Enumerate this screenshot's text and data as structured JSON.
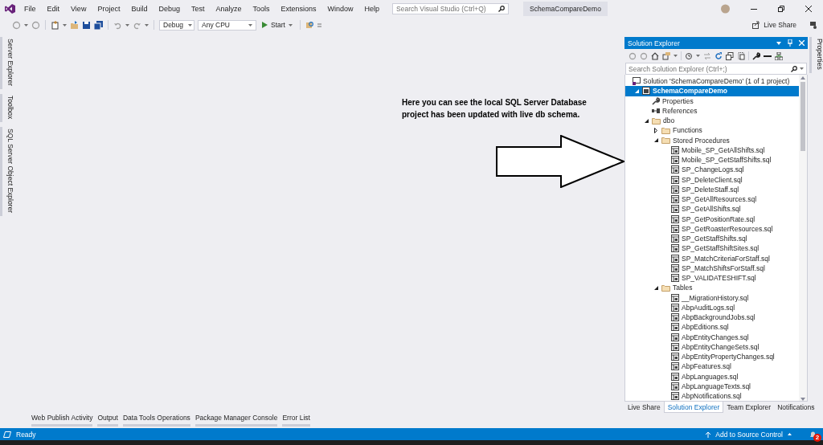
{
  "window": {
    "menu": [
      "File",
      "Edit",
      "View",
      "Project",
      "Build",
      "Debug",
      "Test",
      "Analyze",
      "Tools",
      "Extensions",
      "Window",
      "Help"
    ],
    "search": {
      "placeholder": "Search Visual Studio (Ctrl+Q)"
    },
    "solution_name": "SchemaCompareDemo"
  },
  "toolbar": {
    "configuration": "Debug",
    "platform": "Any CPU",
    "start": "Start",
    "live_share": "Live Share"
  },
  "left_tabs": [
    "Server Explorer",
    "Toolbox",
    "SQL Server Object Explorer"
  ],
  "right_tabs": [
    "Properties"
  ],
  "annotation": {
    "text": "Here you can see the local SQL Server Database\nproject has been updated with live db schema."
  },
  "solution_explorer": {
    "title": "Solution Explorer",
    "search": {
      "placeholder": "Search Solution Explorer (Ctrl+;)"
    },
    "tree": [
      {
        "label": "Solution 'SchemaCompareDemo' (1 of 1 project)",
        "kind": "solution",
        "selected": false,
        "children": [
          {
            "label": "SchemaCompareDemo",
            "kind": "project",
            "selected": true,
            "expanded": true,
            "children": [
              {
                "label": "Properties",
                "kind": "properties",
                "selected": false
              },
              {
                "label": "References",
                "kind": "references",
                "selected": false
              },
              {
                "label": "dbo",
                "kind": "folder",
                "selected": false,
                "expanded": true,
                "children": [
                  {
                    "label": "Functions",
                    "kind": "folder",
                    "selected": false,
                    "expanded": false
                  },
                  {
                    "label": "Stored Procedures",
                    "kind": "folder",
                    "selected": false,
                    "expanded": true,
                    "children": [
                      {
                        "label": "Mobile_SP_GetAllShifts.sql",
                        "kind": "file",
                        "selected": false
                      },
                      {
                        "label": "Mobile_SP_GetStaffShifts.sql",
                        "kind": "file",
                        "selected": false
                      },
                      {
                        "label": "SP_ChangeLogs.sql",
                        "kind": "file",
                        "selected": false
                      },
                      {
                        "label": "SP_DeleteClient.sql",
                        "kind": "file",
                        "selected": false
                      },
                      {
                        "label": "SP_DeleteStaff.sql",
                        "kind": "file",
                        "selected": false
                      },
                      {
                        "label": "SP_GetAllResources.sql",
                        "kind": "file",
                        "selected": false
                      },
                      {
                        "label": "SP_GetAllShifts.sql",
                        "kind": "file",
                        "selected": false
                      },
                      {
                        "label": "SP_GetPositionRate.sql",
                        "kind": "file",
                        "selected": false
                      },
                      {
                        "label": "SP_GetRoasterResources.sql",
                        "kind": "file",
                        "selected": false
                      },
                      {
                        "label": "SP_GetStaffShifts.sql",
                        "kind": "file",
                        "selected": false
                      },
                      {
                        "label": "SP_GetStaffShiftSites.sql",
                        "kind": "file",
                        "selected": false
                      },
                      {
                        "label": "SP_MatchCriteriaForStaff.sql",
                        "kind": "file",
                        "selected": false
                      },
                      {
                        "label": "SP_MatchShiftsForStaff.sql",
                        "kind": "file",
                        "selected": false
                      },
                      {
                        "label": "SP_VALIDATESHIFT.sql",
                        "kind": "file",
                        "selected": false
                      }
                    ]
                  },
                  {
                    "label": "Tables",
                    "kind": "folder",
                    "selected": false,
                    "expanded": true,
                    "children": [
                      {
                        "label": "__MigrationHistory.sql",
                        "kind": "file",
                        "selected": false
                      },
                      {
                        "label": "AbpAuditLogs.sql",
                        "kind": "file",
                        "selected": false
                      },
                      {
                        "label": "AbpBackgroundJobs.sql",
                        "kind": "file",
                        "selected": false
                      },
                      {
                        "label": "AbpEditions.sql",
                        "kind": "file",
                        "selected": false
                      },
                      {
                        "label": "AbpEntityChanges.sql",
                        "kind": "file",
                        "selected": false
                      },
                      {
                        "label": "AbpEntityChangeSets.sql",
                        "kind": "file",
                        "selected": false
                      },
                      {
                        "label": "AbpEntityPropertyChanges.sql",
                        "kind": "file",
                        "selected": false
                      },
                      {
                        "label": "AbpFeatures.sql",
                        "kind": "file",
                        "selected": false
                      },
                      {
                        "label": "AbpLanguages.sql",
                        "kind": "file",
                        "selected": false
                      },
                      {
                        "label": "AbpLanguageTexts.sql",
                        "kind": "file",
                        "selected": false
                      },
                      {
                        "label": "AbpNotifications.sql",
                        "kind": "file",
                        "selected": false
                      }
                    ]
                  }
                ]
              }
            ]
          }
        ]
      }
    ],
    "tabs": [
      {
        "label": "Live Share",
        "selected": false
      },
      {
        "label": "Solution Explorer",
        "selected": true
      },
      {
        "label": "Team Explorer",
        "selected": false
      },
      {
        "label": "Notifications",
        "selected": false
      }
    ]
  },
  "bottom_tabs": [
    "Web Publish Activity",
    "Output",
    "Data Tools Operations",
    "Package Manager Console",
    "Error List"
  ],
  "status_bar": {
    "text": "Ready",
    "source_control": "Add to Source Control",
    "notifications": "2"
  }
}
